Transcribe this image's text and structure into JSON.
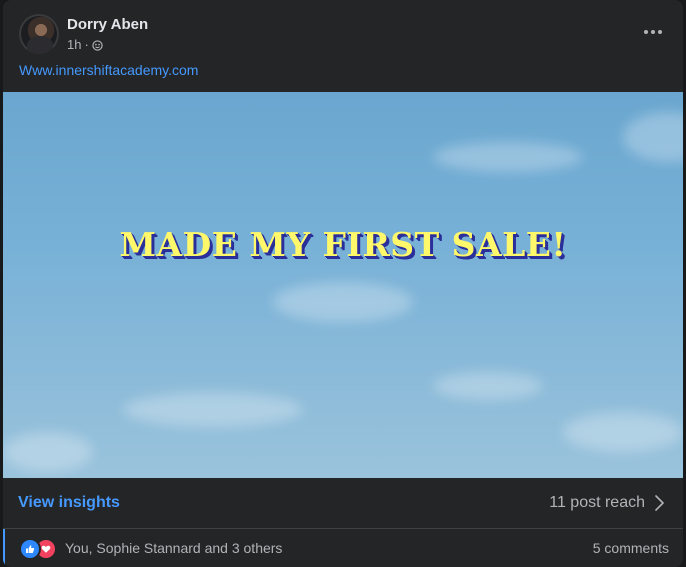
{
  "post": {
    "author_name": "Dorry Aben",
    "time": "1h",
    "separator": "·",
    "link_text": "Www.innershiftacademy.com",
    "image_headline": "MADE MY FIRST SALE!"
  },
  "footer": {
    "view_insights": "View insights",
    "post_reach": "11 post reach",
    "reactions_text": "You, Sophie Stannard and 3 others",
    "comments": "5 comments"
  },
  "icons": {
    "privacy": "globe-icon",
    "menu": "more-options-icon",
    "reach_arrow": "chevron-right-icon",
    "reaction_1": "like-icon",
    "reaction_2": "love-icon"
  },
  "colors": {
    "accent": "#4599ff",
    "card_bg": "#242526",
    "text_primary": "#e4e6eb",
    "text_secondary": "#b0b3b8",
    "headline_fill": "#fff86a",
    "headline_shadow": "#2b2f9a"
  }
}
